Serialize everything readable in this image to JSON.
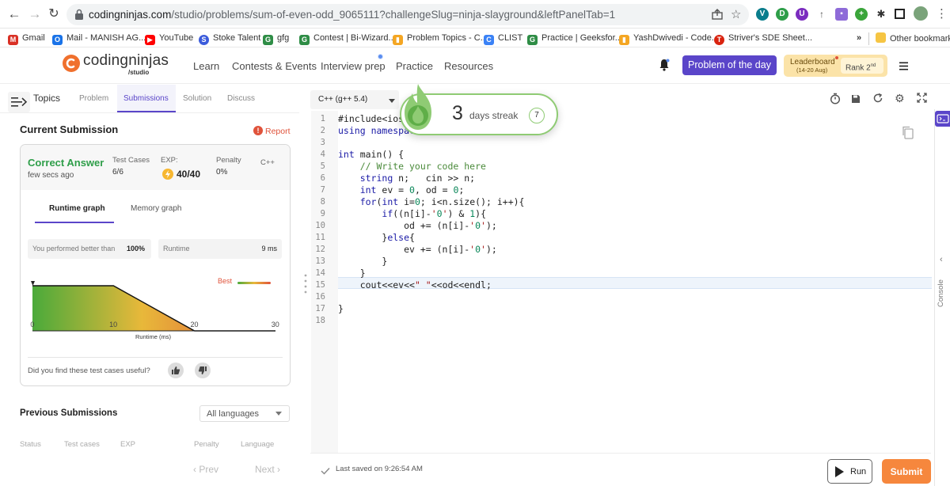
{
  "browser": {
    "url_domain": "codingninjas.com",
    "url_path": "/studio/problems/sum-of-even-odd_9065111?challengeSlug=ninja-slayground&leftPanelTab=1"
  },
  "bookmarks": [
    {
      "label": "Gmail",
      "color": "#d93025"
    },
    {
      "label": "Mail - MANISH AG...",
      "color": "#1a73e8"
    },
    {
      "label": "YouTube",
      "color": "#ff0000"
    },
    {
      "label": "Stoke Talent",
      "color": "#3b5bdb"
    },
    {
      "label": "gfg",
      "color": "#2f8d46"
    },
    {
      "label": "Contest | Bi-Wizard...",
      "color": "#2f8d46"
    },
    {
      "label": "Problem Topics - C...",
      "color": "#f4a623"
    },
    {
      "label": "CLIST",
      "color": "#3b82f6"
    },
    {
      "label": "Practice | Geeksfor...",
      "color": "#2f8d46"
    },
    {
      "label": "YashDwivedi - Code...",
      "color": "#f4a623"
    },
    {
      "label": "Striver's SDE Sheet...",
      "color": "#d9230f"
    }
  ],
  "bookmarks_more": "»",
  "other_bookmarks": "Other bookmarks",
  "site": {
    "logo_main": "codingninjas",
    "logo_sub": "/studio",
    "nav": [
      "Learn",
      "Contests & Events",
      "Interview prep",
      "Practice",
      "Resources"
    ],
    "potd": "Problem of the day",
    "leaderboard_title": "Leaderboard",
    "leaderboard_dates": "(14-20 Aug)",
    "rank_label": "Rank",
    "rank_value": "2",
    "rank_suffix": "nd"
  },
  "left_panel": {
    "topics_label": "Topics",
    "tabs": [
      "Problem",
      "Submissions",
      "Solution",
      "Discuss"
    ],
    "active_tab": "Submissions",
    "current_submission": "Current Submission",
    "report": "Report",
    "status": "Correct Answer",
    "time_ago": "few secs ago",
    "test_cases_label": "Test Cases",
    "test_cases_value": "6/6",
    "exp_label": "EXP:",
    "exp_value": "40/40",
    "penalty_label": "Penalty",
    "penalty_value": "0%",
    "language": "C++",
    "graph_tabs": [
      "Runtime graph",
      "Memory graph"
    ],
    "better_than_label": "You performed better than",
    "better_than_value": "100%",
    "runtime_label": "Runtime",
    "runtime_value": "9 ms",
    "best_label": "Best",
    "feedback_question": "Did you find these test cases useful?",
    "previous_submissions": "Previous Submissions",
    "language_filter": "All languages",
    "table_headers": [
      "Status",
      "Test cases",
      "EXP",
      "Penalty",
      "Language"
    ],
    "prev": "Prev",
    "next": "Next"
  },
  "chart_data": {
    "type": "area",
    "x": [
      0,
      1,
      10,
      20,
      30
    ],
    "y": [
      0.55,
      0.55,
      0.55,
      0.0,
      0.0
    ],
    "x_ticks": [
      "0",
      "10",
      "20",
      "30"
    ],
    "xlim": [
      0,
      30
    ],
    "xlabel": "Runtime (ms)",
    "legend": "Best"
  },
  "editor": {
    "language": "C++ (g++ 5.4)",
    "lines": [
      "#include<iostream>",
      "using namespace std;",
      "",
      "int main() {",
      "    // Write your code here",
      "    string n;   cin >> n;",
      "    int ev = 0, od = 0;",
      "    for(int i=0; i<n.size(); i++){",
      "        if((n[i]-'0') & 1){",
      "            od += (n[i]-'0');",
      "        }else{",
      "            ev += (n[i]-'0');",
      "        }",
      "    }",
      "    cout<<ev<<\" \"<<od<<endl;",
      "",
      "}",
      ""
    ],
    "last_saved": "Last saved on 9:26:54 AM",
    "run": "Run",
    "submit": "Submit",
    "console": "Console"
  },
  "streak": {
    "count": "3",
    "label": "days streak",
    "target": "7"
  },
  "colors": {
    "accent": "#5a45c9",
    "success": "#2e9e49",
    "submit": "#f6873d"
  }
}
